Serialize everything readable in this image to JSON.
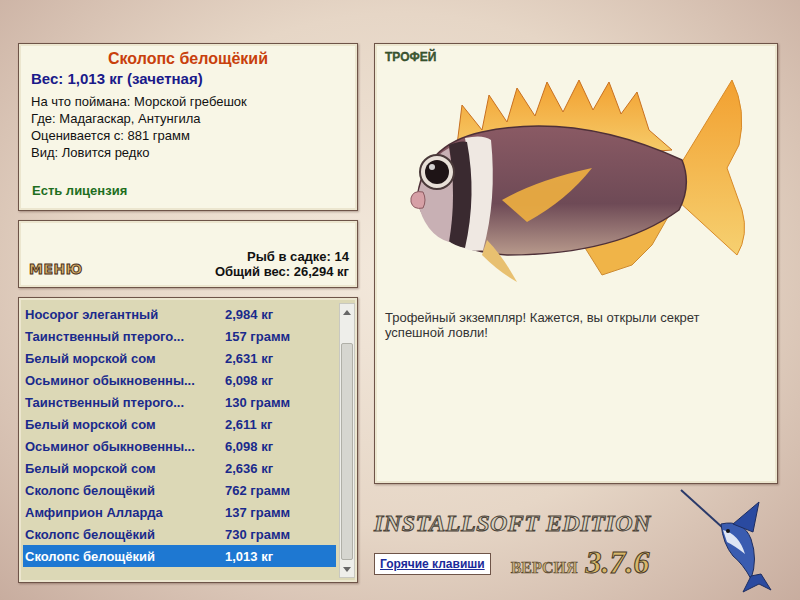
{
  "info": {
    "title": "Сколопс белощёкий",
    "weight": "Вес: 1,013 кг (зачетная)",
    "lines": [
      "На что поймана: Морской гребешок",
      "Где: Мадагаскар, Антунгила",
      "Оценивается с: 881 грамм",
      "Вид: Ловится редко"
    ],
    "license": "Есть лицензия"
  },
  "menu": {
    "label": "МЕНЮ",
    "fish_count": "Рыб в садке: 14",
    "total_weight": "Общий вес: 26,294 кг"
  },
  "catch_list": {
    "rows": [
      {
        "name": "Носорог элегантный",
        "weight": "2,984 кг",
        "selected": false
      },
      {
        "name": "Таинственный птерого...",
        "weight": "157 грамм",
        "selected": false
      },
      {
        "name": "Белый морской сом",
        "weight": "2,631 кг",
        "selected": false
      },
      {
        "name": "Осьминог обыкновенны...",
        "weight": "6,098 кг",
        "selected": false
      },
      {
        "name": "Таинственный птерого...",
        "weight": "130 грамм",
        "selected": false
      },
      {
        "name": "Белый морской сом",
        "weight": "2,611 кг",
        "selected": false
      },
      {
        "name": "Осьминог обыкновенны...",
        "weight": "6,098 кг",
        "selected": false
      },
      {
        "name": "Белый морской сом",
        "weight": "2,636 кг",
        "selected": false
      },
      {
        "name": "Сколопс белощёкий",
        "weight": "762 грамм",
        "selected": false
      },
      {
        "name": "Амфиприон Алларда",
        "weight": "137 грамм",
        "selected": false
      },
      {
        "name": "Сколопс белощёкий",
        "weight": "730 грамм",
        "selected": false
      },
      {
        "name": "Сколопс белощёкий",
        "weight": "1,013 кг",
        "selected": true
      }
    ],
    "scrollbar": {
      "level": 0.9
    }
  },
  "trophy": {
    "badge": "ТРОФЕЙ",
    "message": "Трофейный экземпляр! Кажется, вы открыли секрет успешной ловли!"
  },
  "footer": {
    "edition": "INSTALLSOFT EDITION",
    "version_label": "ВЕРСИЯ",
    "version": "3.7.6",
    "hotkeys_button": "Горячие клавиши"
  }
}
